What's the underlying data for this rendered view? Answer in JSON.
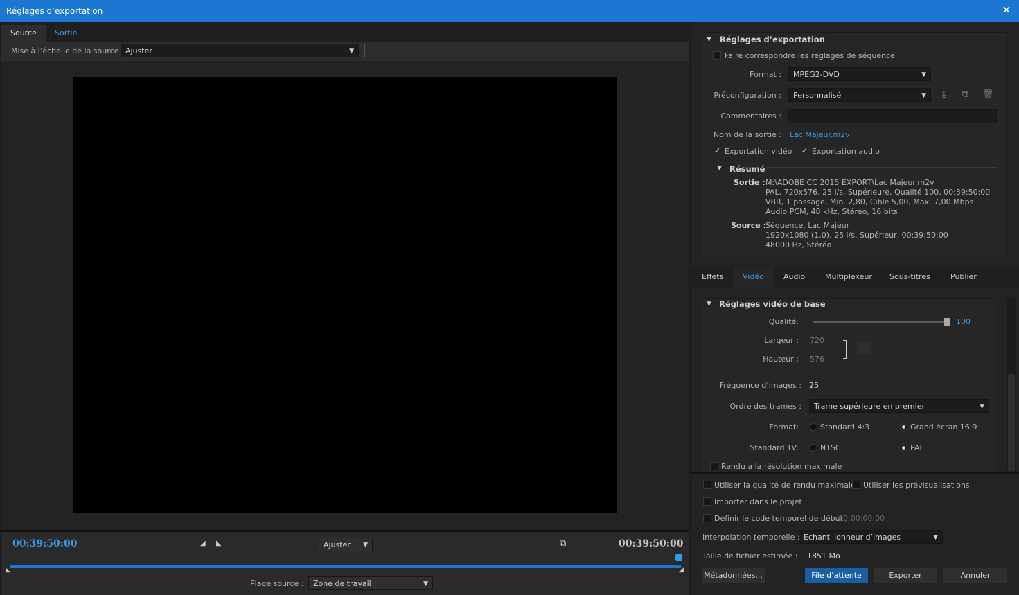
{
  "window": {
    "title": "Réglages d’exportation",
    "close": "✕"
  },
  "left": {
    "tabs": [
      "Source",
      "Sortie"
    ],
    "scale_label": "Mise à l’échelle de la source :",
    "scale_value": "Ajuster",
    "timecode_start": "00:39:50:00",
    "timecode_end": "00:39:50:00",
    "fit_value": "Ajuster",
    "range_label": "Plage source :",
    "range_value": "Zone de travail"
  },
  "export": {
    "header": "Réglages d’exportation",
    "match_sequence": "Faire correspondre les réglages de séquence",
    "format_label": "Format :",
    "format_value": "MPEG2-DVD",
    "preset_label": "Préconfiguration :",
    "preset_value": "Personnalisé",
    "comments_label": "Commentaires :",
    "output_name_label": "Nom de la sortie :",
    "output_name": "Lac Majeur.m2v",
    "export_video": "Exportation vidéo",
    "export_audio": "Exportation audio",
    "summary_header": "Résumé",
    "output_label": "Sortie :",
    "output_lines": [
      "M:\\ADOBE CC 2015 EXPORT\\Lac Majeur.m2v",
      "PAL, 720x576, 25 i/s, Supérieure, Qualité  100, 00:39:50:00",
      "VBR, 1 passage, Min. 2,80, Cible 5,00, Max. 7,00 Mbps",
      "Audio PCM, 48  kHz, Stéréo, 16 bits"
    ],
    "source_label": "Source :",
    "source_lines": [
      "Séquence, Lac Majeur",
      "1920x1080 (1,0), 25  i/s, Supérieur, 00:39:50:00",
      "48000 Hz, Stéréo"
    ]
  },
  "video_tabs": [
    "Effets",
    "Vidéo",
    "Audio",
    "Multiplexeur",
    "Sous-titres",
    "Publier"
  ],
  "video": {
    "header": "Réglages vidéo de base",
    "quality_label": "Qualité:",
    "quality_value": "100",
    "quality_level": 1.0,
    "width_label": "Largeur :",
    "width_value": "720",
    "height_label": "Hauteur :",
    "height_value": "576",
    "fps_label": "Fréquence d’images :",
    "fps_value": "25",
    "field_order_label": "Ordre des trames :",
    "field_order_value": "Trame supérieure en premier",
    "aspect_label": "Format:",
    "aspect_opt1": "Standard 4:3",
    "aspect_opt2": "Grand écran 16:9",
    "tv_label": "Standard TV:",
    "tv_opt1": "NTSC",
    "tv_opt2": "PAL",
    "max_render": "Rendu à la résolution maximale"
  },
  "bottom": {
    "max_quality": "Utiliser la qualité de rendu maximale",
    "use_previews": "Utiliser les prévisualisations",
    "import_project": "Importer dans le projet",
    "set_timecode": "Définir le code temporel de début",
    "timecode_value": "00:00:00:00",
    "interp_label": "Interpolation temporelle :",
    "interp_value": "Echantillonneur d’images",
    "size_label": "Taille de fichier estimée :",
    "size_value": "1851 Mo",
    "metadata_btn": "Métadonnées...",
    "queue_btn": "File d’attente",
    "export_btn": "Exporter",
    "cancel_btn": "Annuler"
  }
}
